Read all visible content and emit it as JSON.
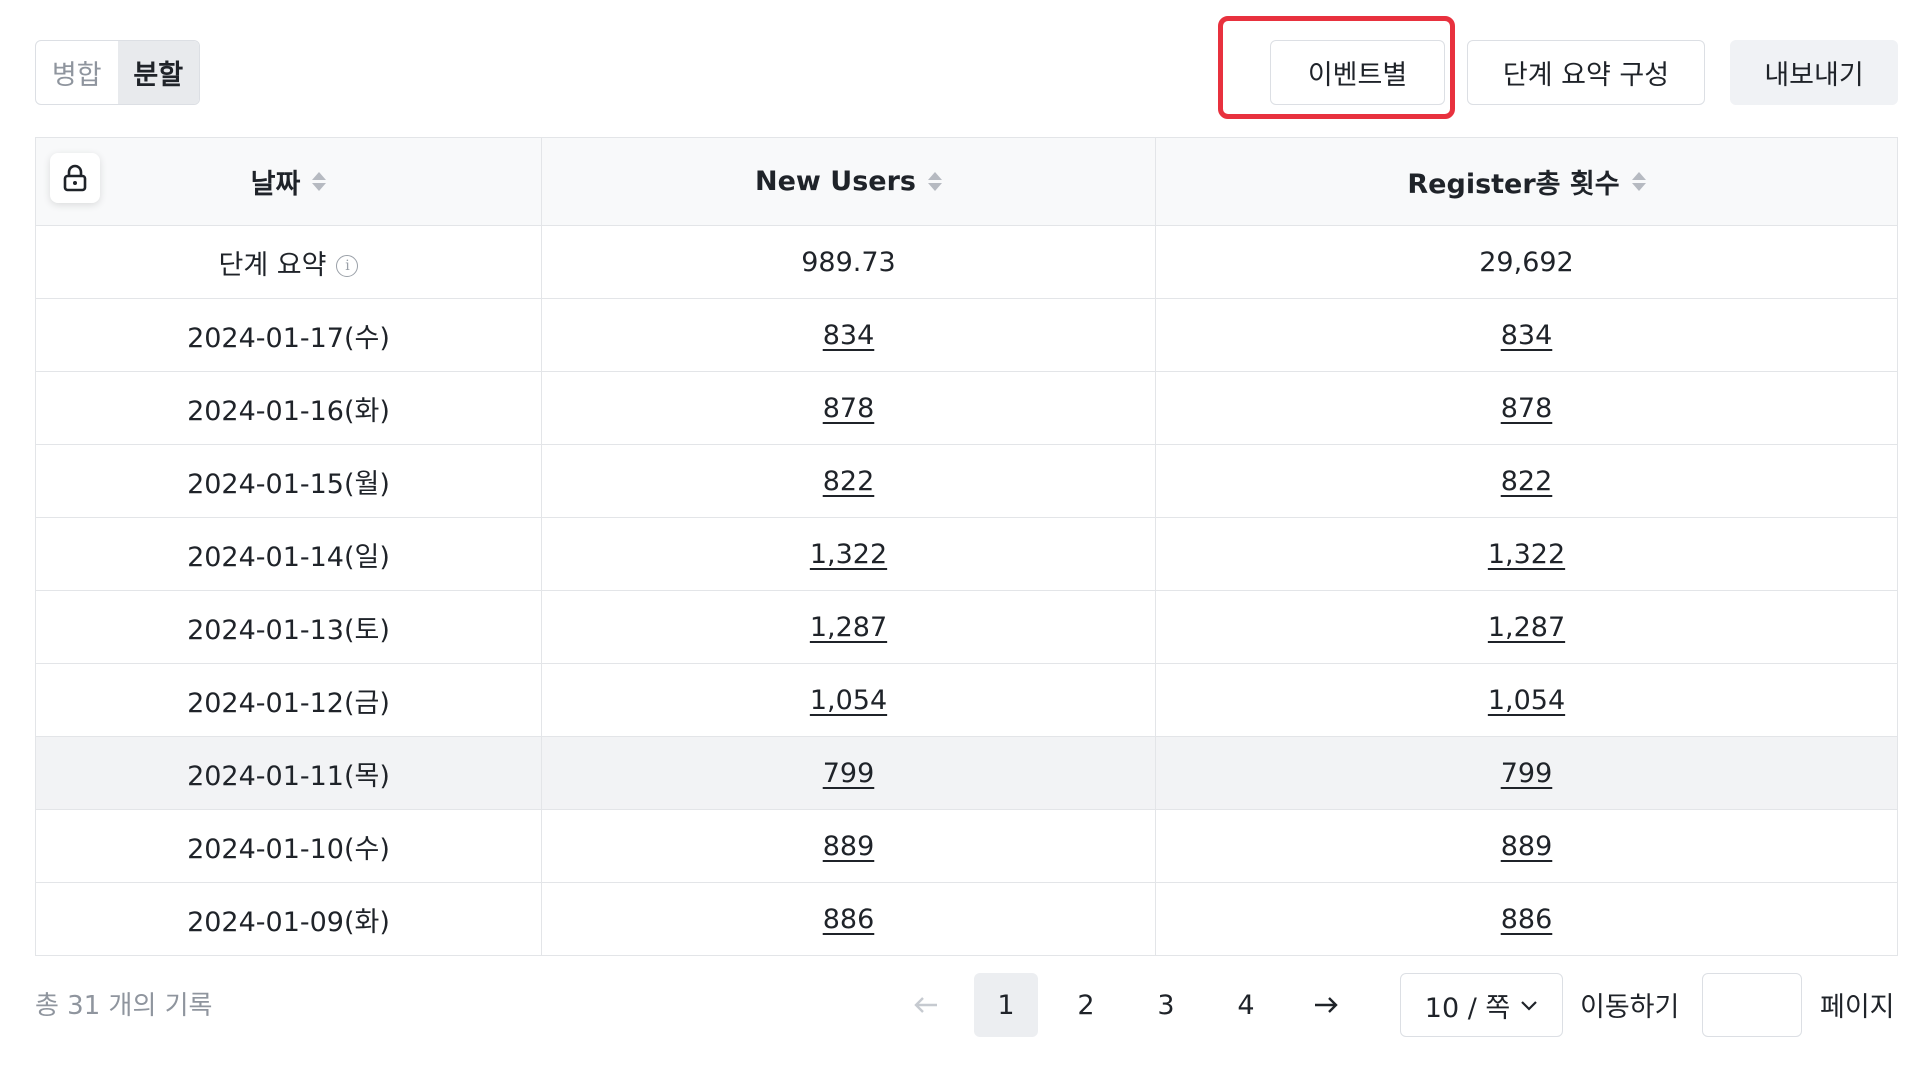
{
  "view_toggle": {
    "merge": "병합",
    "split": "분할",
    "selected": "분할"
  },
  "toolbar": {
    "by_event": "이벤트별",
    "step_summary_config": "단계 요약 구성",
    "export": "내보내기"
  },
  "table": {
    "columns": [
      "날짜",
      "New Users",
      "Register총 횟수"
    ],
    "summary": {
      "label": "단계 요약",
      "new_users": "989.73",
      "register_total": "29,692"
    },
    "rows": [
      {
        "date": "2024-01-17(수)",
        "new_users": "834",
        "register_total": "834"
      },
      {
        "date": "2024-01-16(화)",
        "new_users": "878",
        "register_total": "878"
      },
      {
        "date": "2024-01-15(월)",
        "new_users": "822",
        "register_total": "822"
      },
      {
        "date": "2024-01-14(일)",
        "new_users": "1,322",
        "register_total": "1,322"
      },
      {
        "date": "2024-01-13(토)",
        "new_users": "1,287",
        "register_total": "1,287"
      },
      {
        "date": "2024-01-12(금)",
        "new_users": "1,054",
        "register_total": "1,054"
      },
      {
        "date": "2024-01-11(목)",
        "new_users": "799",
        "register_total": "799"
      },
      {
        "date": "2024-01-10(수)",
        "new_users": "889",
        "register_total": "889"
      },
      {
        "date": "2024-01-09(화)",
        "new_users": "886",
        "register_total": "886"
      }
    ]
  },
  "footer": {
    "total": "총 31 개의 기록",
    "pages": [
      "1",
      "2",
      "3",
      "4"
    ],
    "current_page": "1",
    "page_size": "10 / 쪽",
    "jump_label": "이동하기",
    "jump_value": "",
    "page_label": "페이지"
  },
  "colors": {
    "highlight": "#e8313e",
    "active_segment": "#e8eaed",
    "border": "#e3e5e8"
  }
}
